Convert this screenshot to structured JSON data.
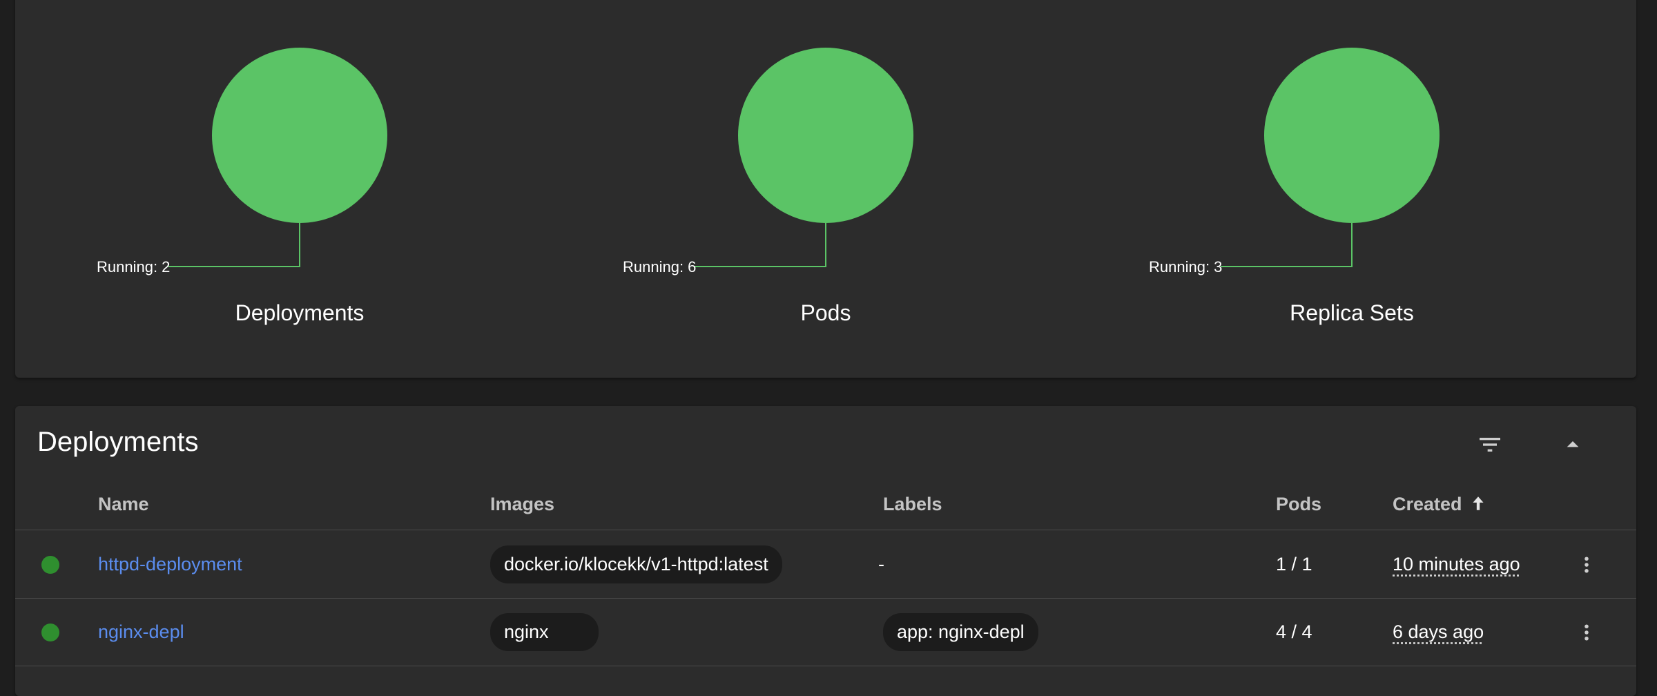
{
  "colors": {
    "running": "#5bc466",
    "status_ok": "#2f8f2f",
    "link": "#5b8def",
    "card": "#2c2c2c",
    "background": "#1e1e1e"
  },
  "charts": [
    {
      "title": "Deployments",
      "label": "Running: 2"
    },
    {
      "title": "Pods",
      "label": "Running: 6"
    },
    {
      "title": "Replica Sets",
      "label": "Running: 3"
    }
  ],
  "chart_data": [
    {
      "type": "pie",
      "title": "Deployments",
      "slices": [
        {
          "name": "Running",
          "value": 2
        }
      ]
    },
    {
      "type": "pie",
      "title": "Pods",
      "slices": [
        {
          "name": "Running",
          "value": 6
        }
      ]
    },
    {
      "type": "pie",
      "title": "Replica Sets",
      "slices": [
        {
          "name": "Running",
          "value": 3
        }
      ]
    }
  ],
  "deployments": {
    "title": "Deployments",
    "filter_icon": "filter-icon",
    "collapse_icon": "arrow-up-icon",
    "columns": {
      "name": "Name",
      "images": "Images",
      "labels": "Labels",
      "pods": "Pods",
      "created": "Created"
    },
    "sort_icon": "arrow-upward-icon",
    "rows": [
      {
        "status": "running",
        "name": "httpd-deployment",
        "image": "docker.io/klocekk/v1-httpd:latest",
        "labels": "-",
        "pods": "1 / 1",
        "created": "10 minutes ago"
      },
      {
        "status": "running",
        "name": "nginx-depl",
        "image": "nginx",
        "labels": "app: nginx-depl",
        "pods": "4 / 4",
        "created": "6 days ago"
      }
    ],
    "row_actions_icon": "more-vert-icon"
  }
}
